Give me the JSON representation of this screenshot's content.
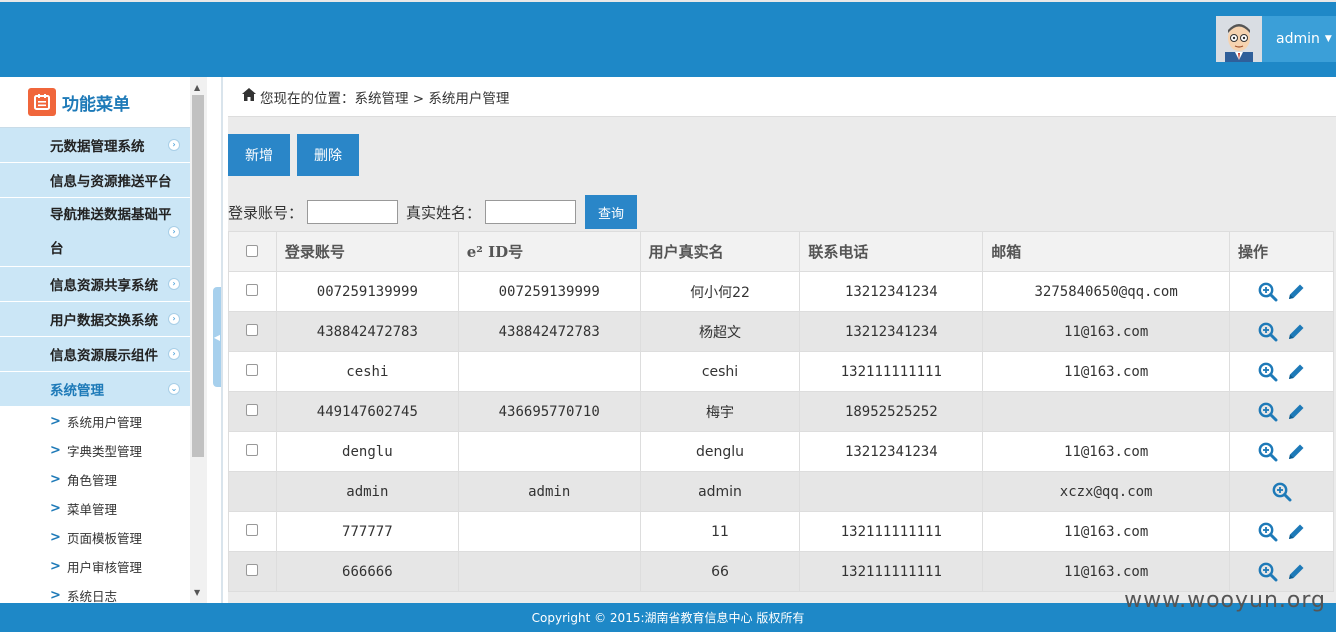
{
  "header": {
    "user_name": "admin"
  },
  "sidebar": {
    "title": "功能菜单",
    "items": [
      {
        "label": "元数据管理系统"
      },
      {
        "label": "信息与资源推送平台"
      },
      {
        "label": "导航推送数据基础平台"
      },
      {
        "label": "信息资源共享系统"
      },
      {
        "label": "用户数据交换系统"
      },
      {
        "label": "信息资源展示组件"
      },
      {
        "label": "系统管理"
      }
    ],
    "sub_items": [
      {
        "label": "系统用户管理"
      },
      {
        "label": "字典类型管理"
      },
      {
        "label": "角色管理"
      },
      {
        "label": "菜单管理"
      },
      {
        "label": "页面模板管理"
      },
      {
        "label": "用户审核管理"
      },
      {
        "label": "系统日志"
      }
    ]
  },
  "breadcrumb": {
    "text": "您现在的位置：系统管理 > 系统用户管理"
  },
  "toolbar": {
    "add_label": "新增",
    "delete_label": "删除"
  },
  "search": {
    "account_label": "登录账号：",
    "name_label": "真实姓名：",
    "query_label": "查询",
    "account_value": "",
    "name_value": ""
  },
  "table": {
    "headers": [
      "登录账号",
      "e² ID号",
      "用户真实名",
      "联系电话",
      "邮箱",
      "操作"
    ],
    "rows": [
      {
        "account": "007259139999",
        "eid": "007259139999",
        "name": "何小何22",
        "phone": "13212341234",
        "email": "3275840650@qq.com",
        "has_checkbox": true,
        "can_edit": true
      },
      {
        "account": "438842472783",
        "eid": "438842472783",
        "name": "杨超文",
        "phone": "13212341234",
        "email": "11@163.com",
        "has_checkbox": true,
        "can_edit": true
      },
      {
        "account": "ceshi",
        "eid": "",
        "name": "ceshi",
        "phone": "132111111111",
        "email": "11@163.com",
        "has_checkbox": true,
        "can_edit": true
      },
      {
        "account": "449147602745",
        "eid": "436695770710",
        "name": "梅宇",
        "phone": "18952525252",
        "email": "",
        "has_checkbox": true,
        "can_edit": true
      },
      {
        "account": "denglu",
        "eid": "",
        "name": "denglu",
        "phone": "13212341234",
        "email": "11@163.com",
        "has_checkbox": true,
        "can_edit": true
      },
      {
        "account": "admin",
        "eid": "admin",
        "name": "admin",
        "phone": "",
        "email": "xczx@qq.com",
        "has_checkbox": false,
        "can_edit": false
      },
      {
        "account": "777777",
        "eid": "",
        "name": "11",
        "phone": "132111111111",
        "email": "11@163.com",
        "has_checkbox": true,
        "can_edit": true
      },
      {
        "account": "666666",
        "eid": "",
        "name": "66",
        "phone": "132111111111",
        "email": "11@163.com",
        "has_checkbox": true,
        "can_edit": true
      }
    ]
  },
  "footer": {
    "text": "Copyright © 2015:湖南省教育信息中心 版权所有"
  },
  "watermark": "www.wooyun.org",
  "colors": {
    "header_blue": "#1e88c7",
    "nav_bg": "#cbe6f6",
    "button_blue": "#2a86c8",
    "accent_orange": "#f0663b"
  }
}
